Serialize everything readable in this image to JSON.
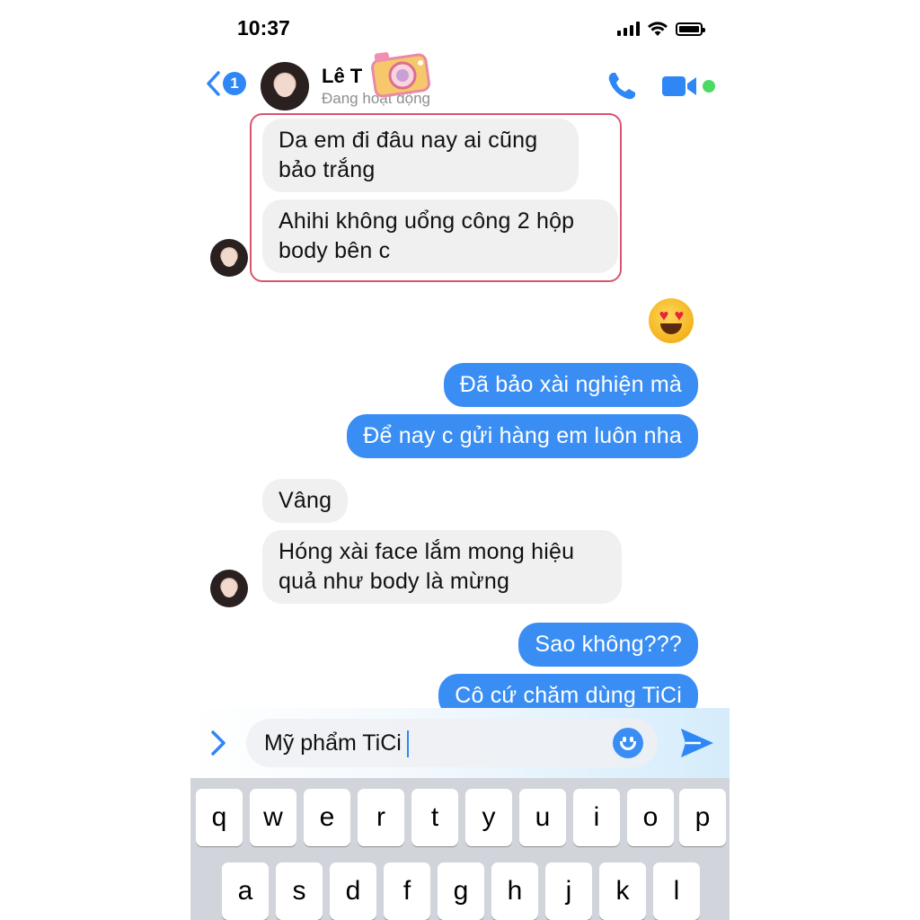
{
  "status_bar": {
    "time": "10:37"
  },
  "header": {
    "back_badge_count": "1",
    "contact_name": "Lê T",
    "contact_status": "Đang hoạt động"
  },
  "messages": {
    "m1": "Da em đi đâu nay ai cũng bảo trắng",
    "m2": "Ahihi không uổng công 2 hộp body bên c",
    "m3": "Đã bảo xài nghiện mà",
    "m4": "Để nay c gửi hàng em luôn nha",
    "m5": "Vâng",
    "m6": "Hóng xài face lắm mong hiệu quả như body là mừng",
    "m7": "Sao không???",
    "m8": "Cô cứ chăm dùng TiCi"
  },
  "reaction_emoji": "heart-eyes-emoji",
  "composer": {
    "input_value": "Mỹ phẩm TiCi"
  },
  "keyboard": {
    "row1": [
      "q",
      "w",
      "e",
      "r",
      "t",
      "y",
      "u",
      "i",
      "o",
      "p"
    ],
    "row2": [
      "a",
      "s",
      "d",
      "f",
      "g",
      "h",
      "j",
      "k",
      "l"
    ]
  },
  "colors": {
    "accent_blue": "#3a8ef3",
    "incoming_bubble": "#f0f0f1",
    "highlight_border": "#d7566d",
    "online_green": "#4cd964"
  }
}
